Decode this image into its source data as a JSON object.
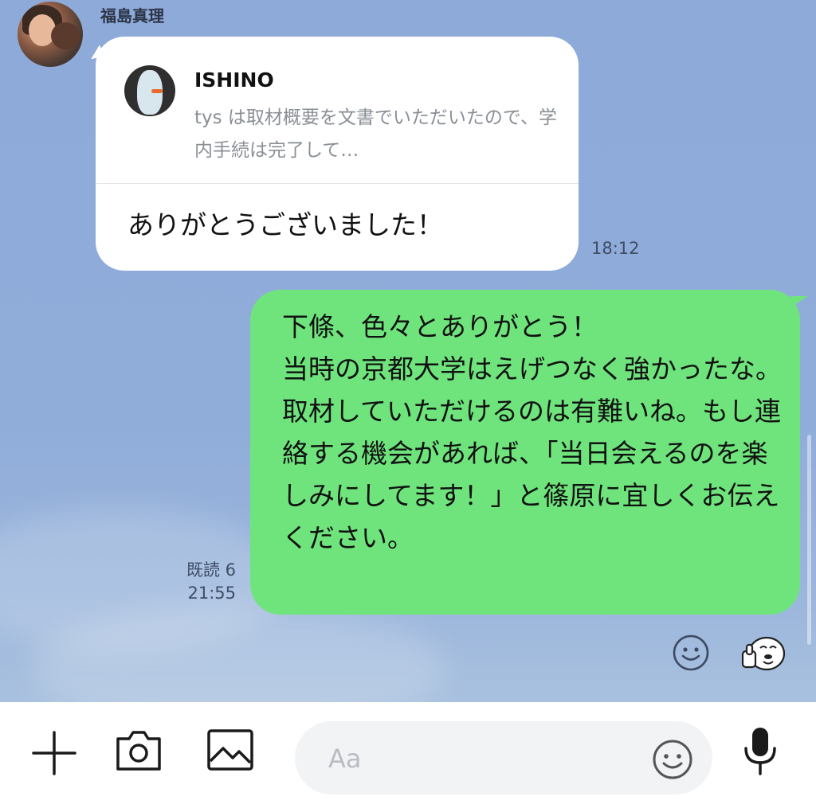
{
  "chat": {
    "incoming": {
      "sender_name": "福島真理",
      "reply": {
        "name": "ISHINO",
        "text": "tys は取材概要を文書でいただいたので、学内手続は完了して…"
      },
      "message": "ありがとうございました！",
      "time": "18:12"
    },
    "outgoing": {
      "message": "下條、色々とありがとう！\n当時の京都大学はえげつなく強かったな。取材していただけるのは有難いね。もし連絡する機会があれば、「当日会えるのを楽しみにしてます！」と篠原に宜しくお伝えください。",
      "read_label": "既読 6",
      "time": "21:55"
    },
    "reactions": [
      "smile-icon",
      "thumbs-up-sticker-icon"
    ]
  },
  "input_bar": {
    "placeholder": "Aa",
    "icons": [
      "plus-icon",
      "camera-icon",
      "image-icon",
      "emoji-icon",
      "microphone-icon"
    ]
  },
  "colors": {
    "background": "#8facd9",
    "outgoing_bubble": "#6fe47d",
    "incoming_bubble": "#ffffff"
  }
}
